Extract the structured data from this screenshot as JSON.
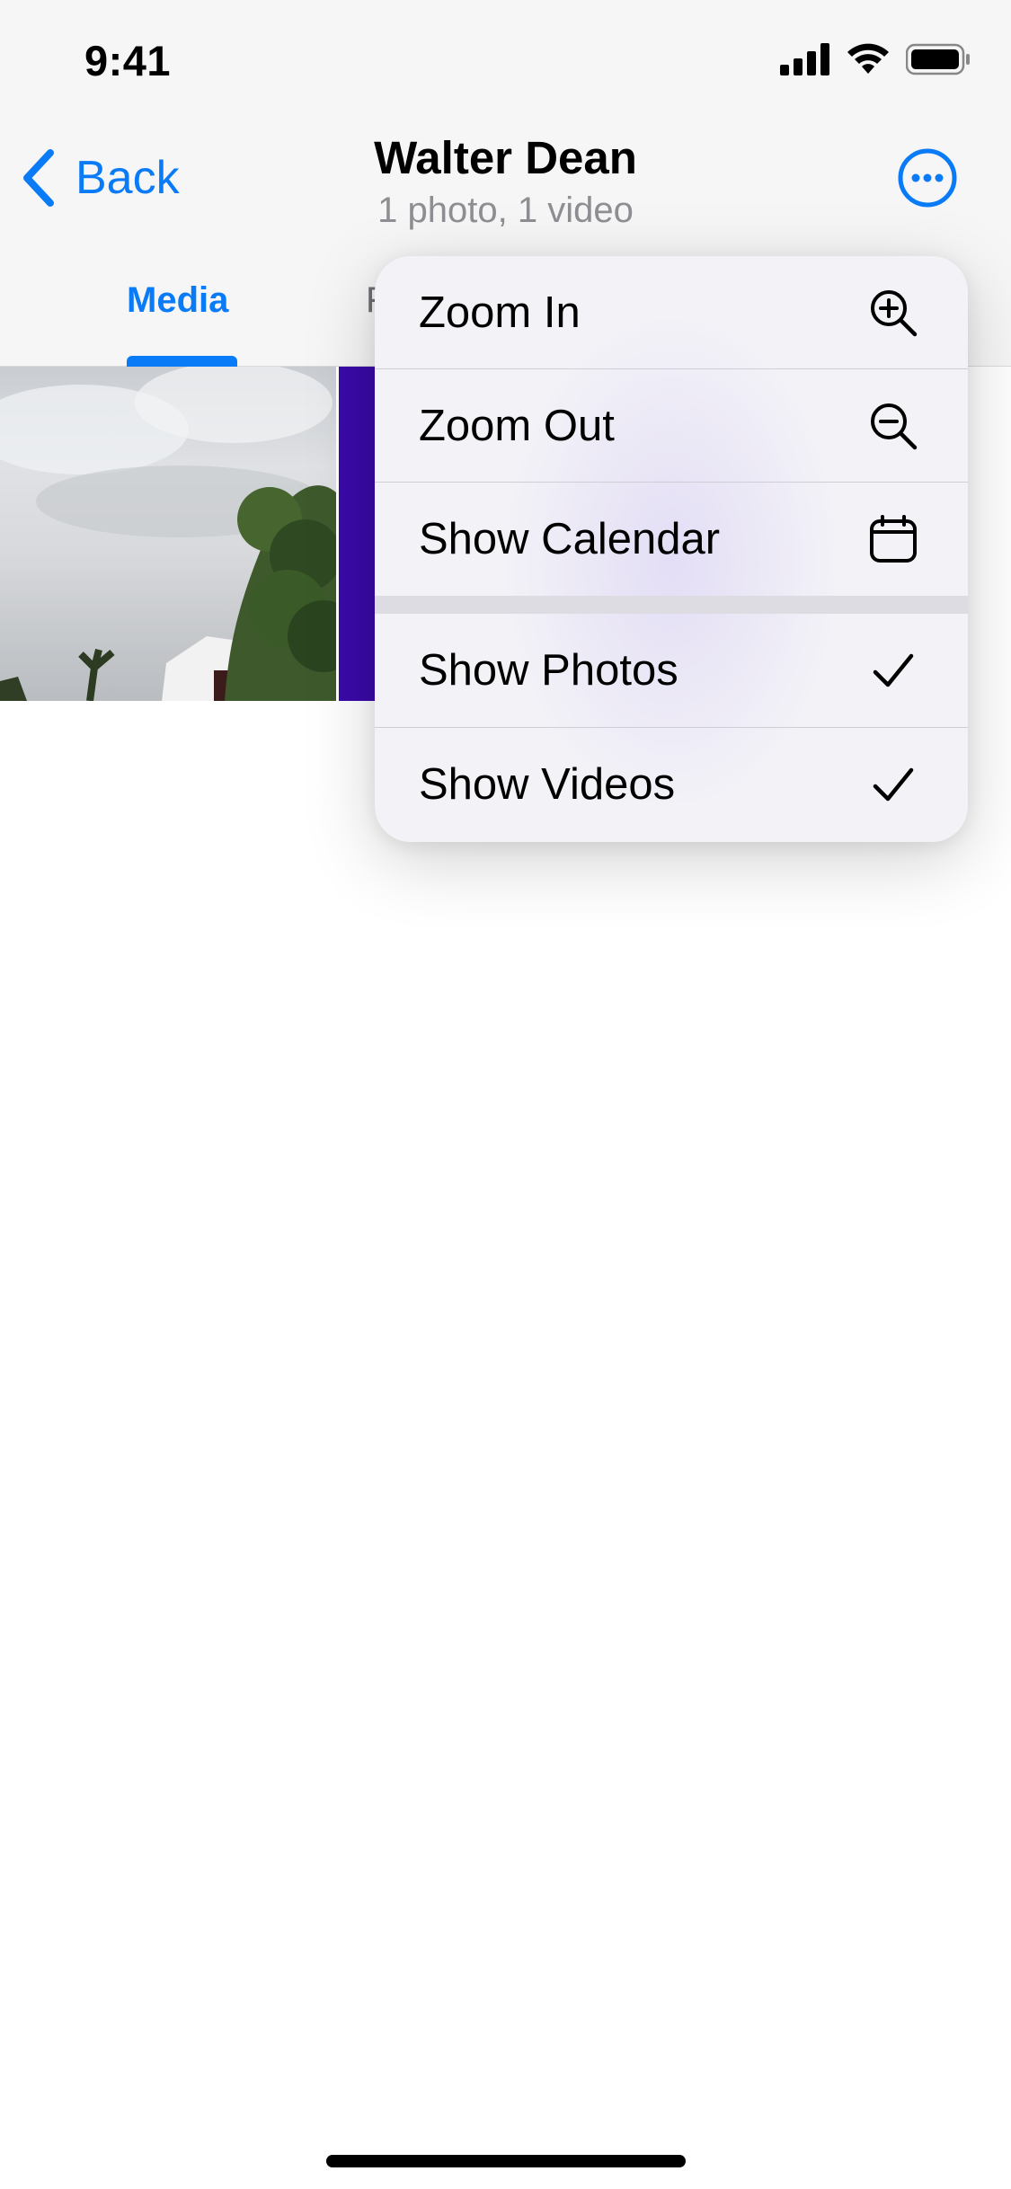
{
  "status_bar": {
    "time": "9:41",
    "icons": [
      "cellular-signal-icon",
      "wifi-icon",
      "battery-icon"
    ]
  },
  "nav": {
    "back_label": "Back",
    "title": "Walter Dean",
    "subtitle": "1 photo, 1 video",
    "more_icon": "ellipsis-circle-icon"
  },
  "tabs": [
    {
      "label": "Media",
      "active": true
    },
    {
      "label": "F",
      "active": false
    }
  ],
  "media": [
    {
      "kind": "photo"
    },
    {
      "kind": "video",
      "color": "#3a0aa8"
    }
  ],
  "menu": {
    "items": [
      {
        "label": "Zoom In",
        "icon": "zoom-in-icon"
      },
      {
        "label": "Zoom Out",
        "icon": "zoom-out-icon"
      },
      {
        "label": "Show Calendar",
        "icon": "calendar-icon"
      },
      {
        "label": "Show Photos",
        "icon": "checkmark-icon",
        "checked": true
      },
      {
        "label": "Show Videos",
        "icon": "checkmark-icon",
        "checked": true
      }
    ]
  },
  "colors": {
    "accent": "#0a7bf7",
    "secondary_text": "#8e8e93",
    "video_tile": "#3a0aa8"
  }
}
